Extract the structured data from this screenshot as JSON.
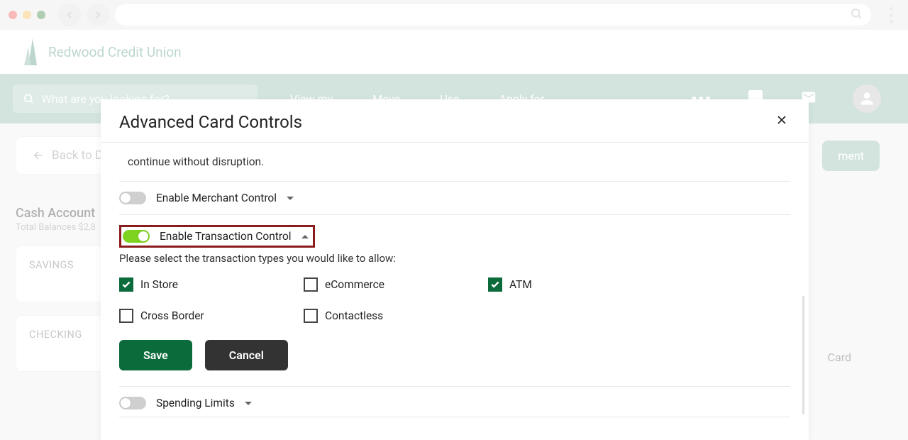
{
  "brand": {
    "name": "Redwood Credit Union"
  },
  "search": {
    "placeholder": "What are you looking for?"
  },
  "nav": {
    "items": [
      "View my",
      "Move",
      "Use",
      "Apply for"
    ]
  },
  "back": {
    "label": "Back to Da"
  },
  "action_button": {
    "label_fragment": "ment"
  },
  "cash": {
    "title": "Cash Account",
    "subtitle_fragment": "Total Balances $2,8"
  },
  "accounts": [
    {
      "label": "SAVINGS"
    },
    {
      "label": "CHECKING"
    }
  ],
  "card_word": "Card",
  "modal": {
    "title": "Advanced Card Controls",
    "leading_text_fragment": "continue without disruption.",
    "merchant": {
      "label": "Enable Merchant Control",
      "enabled": false
    },
    "transaction": {
      "label": "Enable Transaction Control",
      "enabled": true,
      "help_text": "Please select the transaction types you would like to allow:",
      "options": [
        {
          "label": "In Store",
          "checked": true
        },
        {
          "label": "eCommerce",
          "checked": false
        },
        {
          "label": "ATM",
          "checked": true
        },
        {
          "label": "Cross Border",
          "checked": false
        },
        {
          "label": "Contactless",
          "checked": false
        }
      ],
      "save_label": "Save",
      "cancel_label": "Cancel"
    },
    "spending": {
      "label": "Spending Limits",
      "enabled": false
    }
  }
}
